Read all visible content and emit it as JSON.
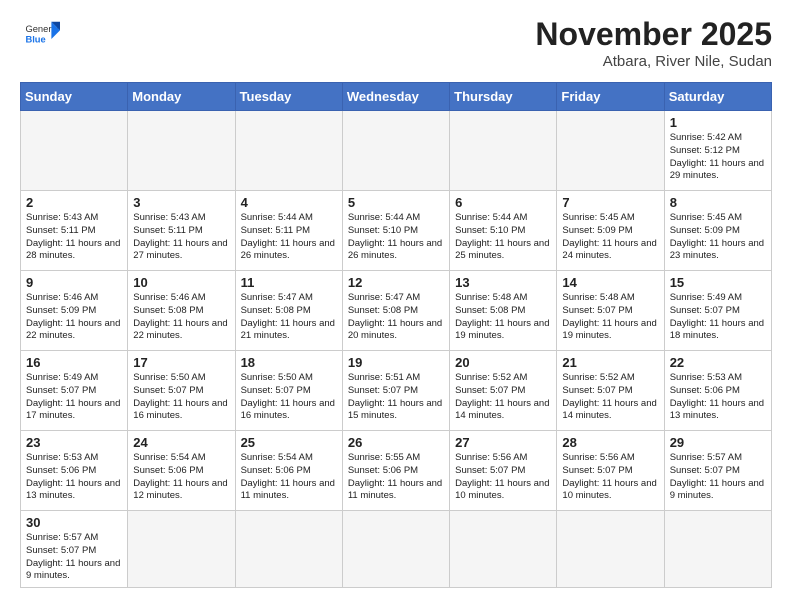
{
  "header": {
    "logo_general": "General",
    "logo_blue": "Blue",
    "month_title": "November 2025",
    "subtitle": "Atbara, River Nile, Sudan"
  },
  "weekdays": [
    "Sunday",
    "Monday",
    "Tuesday",
    "Wednesday",
    "Thursday",
    "Friday",
    "Saturday"
  ],
  "weeks": [
    [
      {
        "day": "",
        "text": ""
      },
      {
        "day": "",
        "text": ""
      },
      {
        "day": "",
        "text": ""
      },
      {
        "day": "",
        "text": ""
      },
      {
        "day": "",
        "text": ""
      },
      {
        "day": "",
        "text": ""
      },
      {
        "day": "1",
        "text": "Sunrise: 5:42 AM\nSunset: 5:12 PM\nDaylight: 11 hours\nand 29 minutes."
      }
    ],
    [
      {
        "day": "2",
        "text": "Sunrise: 5:43 AM\nSunset: 5:11 PM\nDaylight: 11 hours\nand 28 minutes."
      },
      {
        "day": "3",
        "text": "Sunrise: 5:43 AM\nSunset: 5:11 PM\nDaylight: 11 hours\nand 27 minutes."
      },
      {
        "day": "4",
        "text": "Sunrise: 5:44 AM\nSunset: 5:11 PM\nDaylight: 11 hours\nand 26 minutes."
      },
      {
        "day": "5",
        "text": "Sunrise: 5:44 AM\nSunset: 5:10 PM\nDaylight: 11 hours\nand 26 minutes."
      },
      {
        "day": "6",
        "text": "Sunrise: 5:44 AM\nSunset: 5:10 PM\nDaylight: 11 hours\nand 25 minutes."
      },
      {
        "day": "7",
        "text": "Sunrise: 5:45 AM\nSunset: 5:09 PM\nDaylight: 11 hours\nand 24 minutes."
      },
      {
        "day": "8",
        "text": "Sunrise: 5:45 AM\nSunset: 5:09 PM\nDaylight: 11 hours\nand 23 minutes."
      }
    ],
    [
      {
        "day": "9",
        "text": "Sunrise: 5:46 AM\nSunset: 5:09 PM\nDaylight: 11 hours\nand 22 minutes."
      },
      {
        "day": "10",
        "text": "Sunrise: 5:46 AM\nSunset: 5:08 PM\nDaylight: 11 hours\nand 22 minutes."
      },
      {
        "day": "11",
        "text": "Sunrise: 5:47 AM\nSunset: 5:08 PM\nDaylight: 11 hours\nand 21 minutes."
      },
      {
        "day": "12",
        "text": "Sunrise: 5:47 AM\nSunset: 5:08 PM\nDaylight: 11 hours\nand 20 minutes."
      },
      {
        "day": "13",
        "text": "Sunrise: 5:48 AM\nSunset: 5:08 PM\nDaylight: 11 hours\nand 19 minutes."
      },
      {
        "day": "14",
        "text": "Sunrise: 5:48 AM\nSunset: 5:07 PM\nDaylight: 11 hours\nand 19 minutes."
      },
      {
        "day": "15",
        "text": "Sunrise: 5:49 AM\nSunset: 5:07 PM\nDaylight: 11 hours\nand 18 minutes."
      }
    ],
    [
      {
        "day": "16",
        "text": "Sunrise: 5:49 AM\nSunset: 5:07 PM\nDaylight: 11 hours\nand 17 minutes."
      },
      {
        "day": "17",
        "text": "Sunrise: 5:50 AM\nSunset: 5:07 PM\nDaylight: 11 hours\nand 16 minutes."
      },
      {
        "day": "18",
        "text": "Sunrise: 5:50 AM\nSunset: 5:07 PM\nDaylight: 11 hours\nand 16 minutes."
      },
      {
        "day": "19",
        "text": "Sunrise: 5:51 AM\nSunset: 5:07 PM\nDaylight: 11 hours\nand 15 minutes."
      },
      {
        "day": "20",
        "text": "Sunrise: 5:52 AM\nSunset: 5:07 PM\nDaylight: 11 hours\nand 14 minutes."
      },
      {
        "day": "21",
        "text": "Sunrise: 5:52 AM\nSunset: 5:07 PM\nDaylight: 11 hours\nand 14 minutes."
      },
      {
        "day": "22",
        "text": "Sunrise: 5:53 AM\nSunset: 5:06 PM\nDaylight: 11 hours\nand 13 minutes."
      }
    ],
    [
      {
        "day": "23",
        "text": "Sunrise: 5:53 AM\nSunset: 5:06 PM\nDaylight: 11 hours\nand 13 minutes."
      },
      {
        "day": "24",
        "text": "Sunrise: 5:54 AM\nSunset: 5:06 PM\nDaylight: 11 hours\nand 12 minutes."
      },
      {
        "day": "25",
        "text": "Sunrise: 5:54 AM\nSunset: 5:06 PM\nDaylight: 11 hours\nand 11 minutes."
      },
      {
        "day": "26",
        "text": "Sunrise: 5:55 AM\nSunset: 5:06 PM\nDaylight: 11 hours\nand 11 minutes."
      },
      {
        "day": "27",
        "text": "Sunrise: 5:56 AM\nSunset: 5:07 PM\nDaylight: 11 hours\nand 10 minutes."
      },
      {
        "day": "28",
        "text": "Sunrise: 5:56 AM\nSunset: 5:07 PM\nDaylight: 11 hours\nand 10 minutes."
      },
      {
        "day": "29",
        "text": "Sunrise: 5:57 AM\nSunset: 5:07 PM\nDaylight: 11 hours\nand 9 minutes."
      }
    ],
    [
      {
        "day": "30",
        "text": "Sunrise: 5:57 AM\nSunset: 5:07 PM\nDaylight: 11 hours\nand 9 minutes."
      },
      {
        "day": "",
        "text": ""
      },
      {
        "day": "",
        "text": ""
      },
      {
        "day": "",
        "text": ""
      },
      {
        "day": "",
        "text": ""
      },
      {
        "day": "",
        "text": ""
      },
      {
        "day": "",
        "text": ""
      }
    ]
  ]
}
